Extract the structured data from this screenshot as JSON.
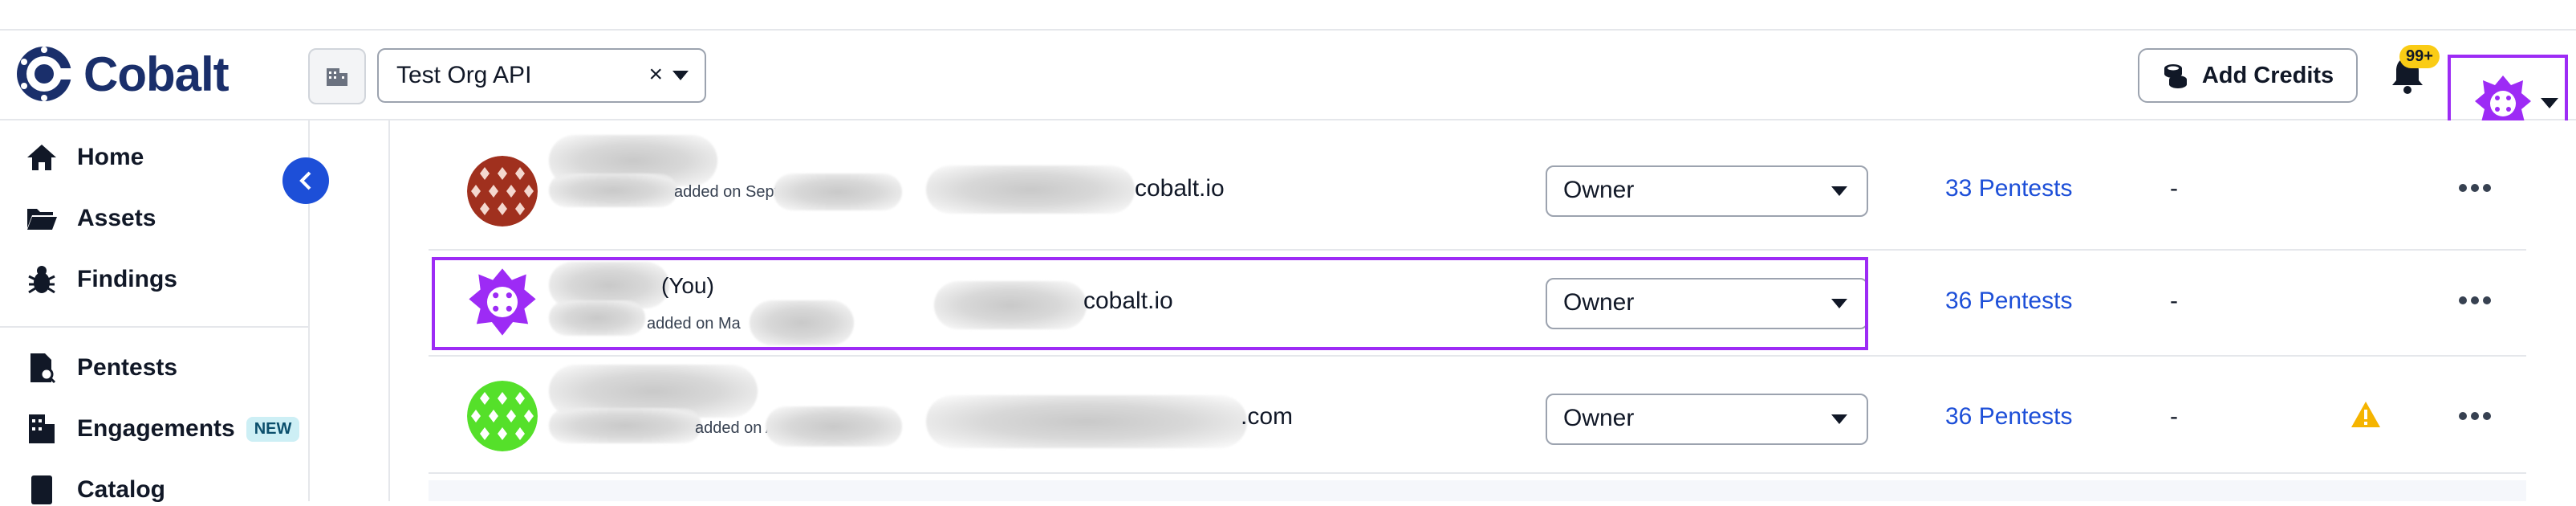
{
  "app": {
    "logo_text": "Cobalt"
  },
  "header": {
    "org_select": {
      "value": "Test Org API",
      "clear_glyph": "×"
    },
    "add_credits_label": "Add Credits",
    "notifications_badge": "99+"
  },
  "sidebar": {
    "items": [
      {
        "label": "Home",
        "icon": "home-icon"
      },
      {
        "label": "Assets",
        "icon": "folder-icon"
      },
      {
        "label": "Findings",
        "icon": "bug-icon"
      },
      {
        "label": "Pentests",
        "icon": "pentest-doc-icon"
      },
      {
        "label": "Engagements",
        "icon": "building-icon",
        "badge": "NEW"
      },
      {
        "label": "Catalog",
        "icon": "book-icon"
      }
    ]
  },
  "members": [
    {
      "added_text": "added on Septe",
      "email_suffix": "cobalt.io",
      "you_label": "",
      "role": "Owner",
      "pentests": "33 Pentests",
      "last": "-",
      "warning": false,
      "avatar_color": "#a0301e"
    },
    {
      "added_text": "added on Ma",
      "email_suffix": "cobalt.io",
      "you_label": "(You)",
      "role": "Owner",
      "pentests": "36 Pentests",
      "last": "-",
      "warning": false,
      "avatar_color": "#9d2bf5"
    },
    {
      "added_text": "added on A",
      "email_suffix": ".com",
      "you_label": "",
      "role": "Owner",
      "pentests": "36 Pentests",
      "last": "-",
      "warning": true,
      "avatar_color": "#55e02a"
    }
  ],
  "colors": {
    "accent": "#9d2bf5",
    "link": "#1d4fd8",
    "brand": "#1a2f6b",
    "badge": "#facc15",
    "warning": "#f5b400"
  }
}
